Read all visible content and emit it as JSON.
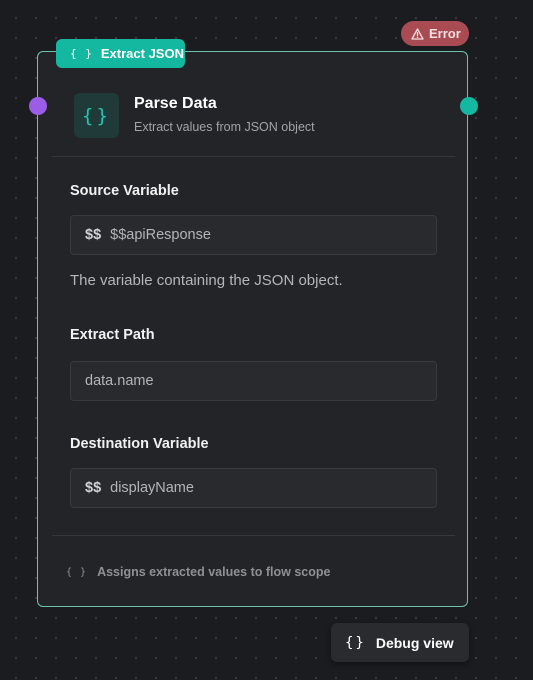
{
  "node": {
    "type_badge": {
      "icon": "{}",
      "label": "Extract JSON"
    },
    "status_badge": {
      "icon": "warning-triangle-icon",
      "label": "Error"
    },
    "header": {
      "icon": "{}",
      "title": "Parse Data",
      "subtitle": "Extract values from JSON object"
    },
    "fields": {
      "source": {
        "label": "Source Variable",
        "prefix": "$$",
        "value": "$$apiResponse",
        "help": "The variable containing the JSON object."
      },
      "path": {
        "label": "Extract Path",
        "value": "data.name"
      },
      "destination": {
        "label": "Destination Variable",
        "prefix": "$$",
        "value": "displayName"
      }
    },
    "footer": {
      "icon": "{}",
      "text": "Assigns extracted values to flow scope"
    }
  },
  "debug_button": {
    "icon": "{}",
    "label": "Debug view"
  },
  "colors": {
    "accent": "#14b8a0",
    "input_port": "#9b5de5",
    "error": "#a94b52",
    "background": "#1b1c1f"
  }
}
